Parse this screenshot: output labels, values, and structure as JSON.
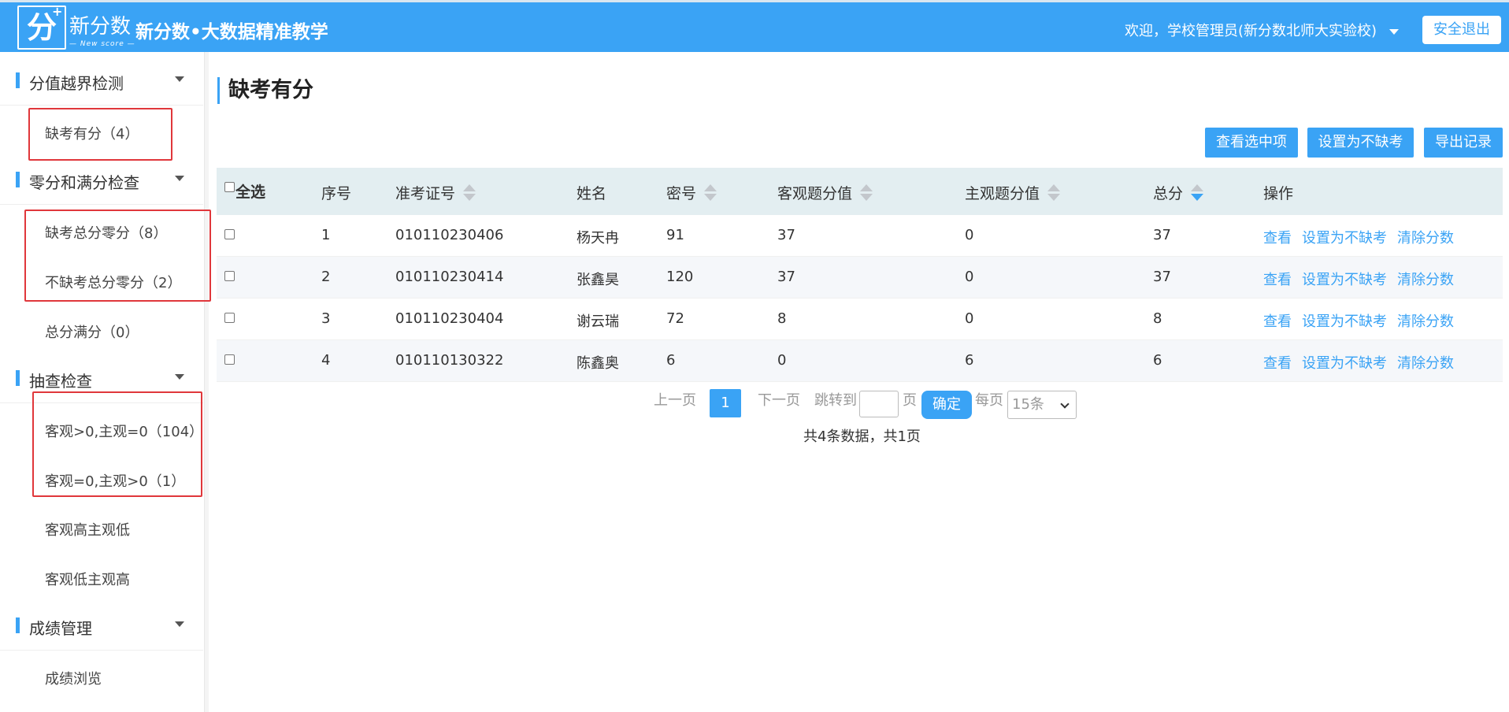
{
  "header": {
    "logo_char": "分",
    "logo_plus": "+",
    "logo_name": "新分数",
    "logo_sub": "— New score —",
    "title": "新分数•大数据精准教学",
    "welcome": "欢迎，学校管理员(新分数北师大实验校)",
    "logout": "安全退出"
  },
  "sidebar": {
    "groups": [
      {
        "label": "分值越界检测",
        "items": [
          "缺考有分（4）"
        ]
      },
      {
        "label": "零分和满分检查",
        "items": [
          "缺考总分零分（8）",
          "不缺考总分零分（2）",
          "总分满分（0）"
        ]
      },
      {
        "label": "抽查检查",
        "items": [
          "客观>0,主观=0（104）",
          "客观=0,主观>0（1）",
          "客观高主观低",
          "客观低主观高"
        ]
      },
      {
        "label": "成绩管理",
        "items": [
          "成绩浏览"
        ]
      }
    ]
  },
  "main": {
    "title": "缺考有分",
    "buttons": {
      "view_selected": "查看选中项",
      "set_not_absent": "设置为不缺考",
      "export": "导出记录"
    },
    "table": {
      "headers": [
        "全选",
        "序号",
        "准考证号",
        "姓名",
        "密号",
        "客观题分值",
        "主观题分值",
        "总分",
        "操作"
      ],
      "rows": [
        [
          "1",
          "010110230406",
          "杨天冉",
          "91",
          "37",
          "0",
          "37"
        ],
        [
          "2",
          "010110230414",
          "张鑫昊",
          "120",
          "37",
          "0",
          "37"
        ],
        [
          "3",
          "010110230404",
          "谢云瑞",
          "72",
          "8",
          "0",
          "8"
        ],
        [
          "4",
          "010110130322",
          "陈鑫奥",
          "6",
          "0",
          "6",
          "6"
        ]
      ],
      "actions": [
        "查看",
        "设置为不缺考",
        "清除分数"
      ]
    },
    "pager": {
      "prev": "上一页",
      "current": "1",
      "next": "下一页",
      "jump_to": "跳转到",
      "page_unit": "页",
      "confirm": "确定",
      "per_page_label": "每页",
      "per_page": "15条",
      "summary": "共4条数据，共1页"
    }
  },
  "colors": {
    "accent": "#3aa3f5",
    "highlight": "#e0373b",
    "header_row": "#e3eef1"
  }
}
